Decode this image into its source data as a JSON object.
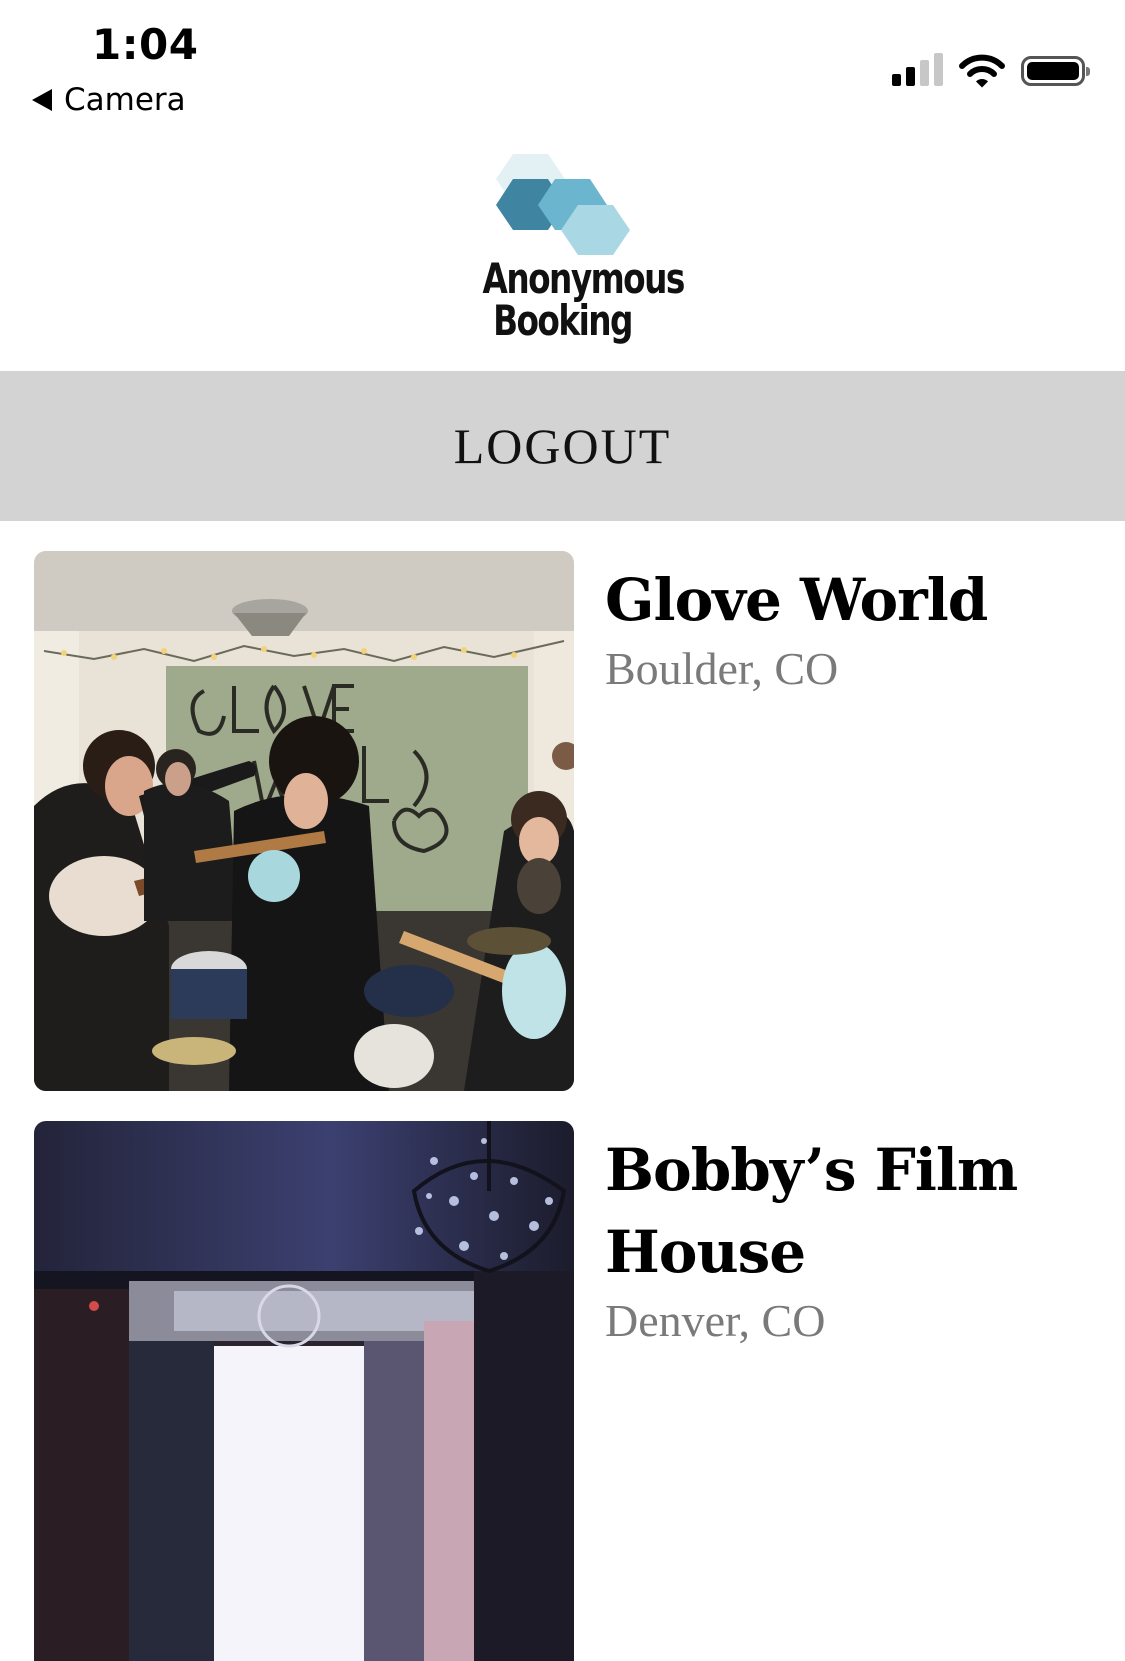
{
  "status_bar": {
    "time": "1:04",
    "back_label": "Camera",
    "icons": [
      "back-arrow-icon",
      "cellular-signal-icon",
      "wifi-icon",
      "battery-icon"
    ],
    "signal_bars_filled": 2,
    "signal_bars_total": 4
  },
  "logo": {
    "line1": "Anonymous",
    "line2": "Booking",
    "colors": [
      "#e3f1f5",
      "#3f85a2",
      "#6bb5cf",
      "#a9d7e3"
    ]
  },
  "nav": {
    "logout_label": "LOGOUT"
  },
  "venues": [
    {
      "name": "Glove World",
      "location": "Boulder, CO",
      "photo": "band-performing-in-living-room"
    },
    {
      "name": "Bobby’s Film House",
      "location": "Denver, CO",
      "photo": "room-with-chandelier"
    }
  ]
}
